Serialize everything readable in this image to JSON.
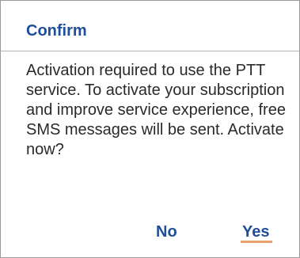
{
  "dialog": {
    "title": "Confirm",
    "message": "Activation required to use the PTT service. To activate your subscription and improve service experience, free SMS messages will be sent. Activate now?",
    "buttons": {
      "no_label": "No",
      "yes_label": "Yes"
    },
    "colors": {
      "accent": "#1f4e9a",
      "focus_underline": "#e8a26e",
      "text": "#2a2a2a"
    }
  }
}
